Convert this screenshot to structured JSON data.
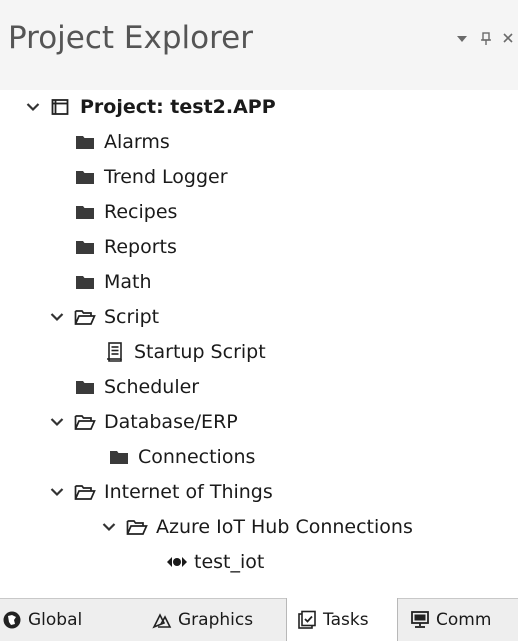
{
  "panel": {
    "title": "Project Explorer"
  },
  "tree": {
    "project": "Project: test2.APP",
    "items": {
      "alarms": "Alarms",
      "trend_logger": "Trend Logger",
      "recipes": "Recipes",
      "reports": "Reports",
      "math": "Math",
      "script": "Script",
      "startup_script": "Startup Script",
      "scheduler": "Scheduler",
      "database_erp": "Database/ERP",
      "connections": "Connections",
      "internet_of_things": "Internet of Things",
      "azure_iot_hub_connections": "Azure IoT Hub Connections",
      "test_iot": "test_iot"
    }
  },
  "tabs": {
    "global": "Global",
    "graphics": "Graphics",
    "tasks": "Tasks",
    "comm": "Comm",
    "active": "tasks"
  },
  "colors": {
    "header_bg": "#f5f5f5",
    "title_text": "#555555",
    "tab_strip_bg": "#eeeeee",
    "active_tab_bg": "#ffffff"
  },
  "icons": {
    "dropdown": "caret-down-icon",
    "pin": "pin-icon",
    "close": "close-icon",
    "expanded": "chevron-down-icon",
    "folder_closed": "folder-icon",
    "folder_open": "folder-open-icon",
    "project": "project-icon",
    "script_doc": "script-document-icon",
    "iot_device": "iot-device-icon",
    "global": "global-icon",
    "graphics": "graphics-icon",
    "tasks": "tasks-icon",
    "comm": "comm-icon"
  }
}
